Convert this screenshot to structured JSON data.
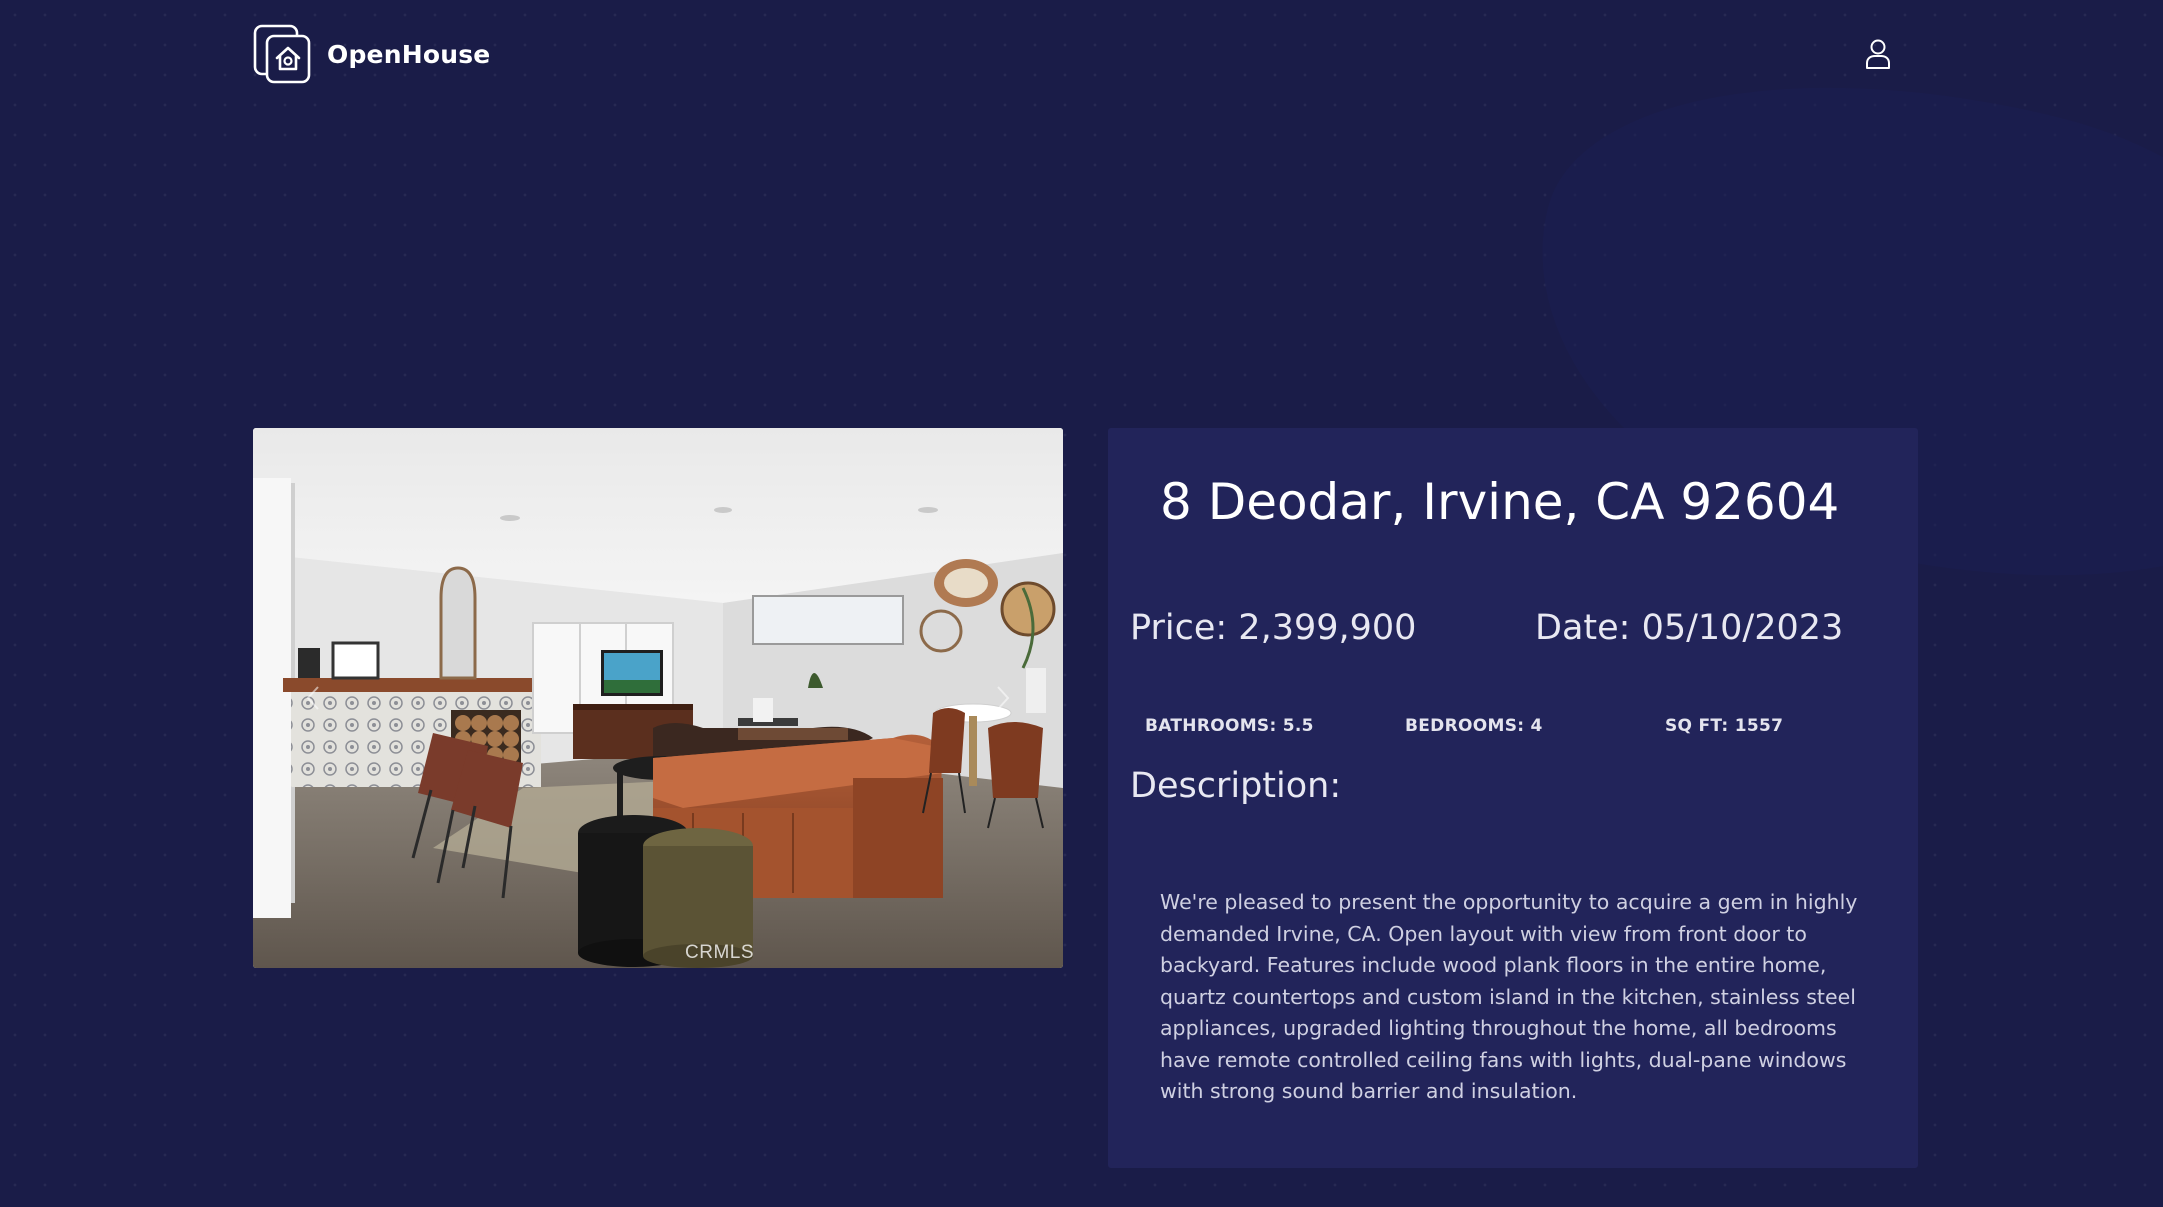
{
  "header": {
    "brand_name": "OpenHouse",
    "logo_icon": "house-logo-icon",
    "user_icon": "user-account-icon"
  },
  "gallery": {
    "watermark": "CRMLS",
    "prev_icon": "chevron-left-icon",
    "next_icon": "chevron-right-icon"
  },
  "listing": {
    "address": "8 Deodar, Irvine, CA 92604",
    "price_text": "Price: 2,399,900",
    "date_text": "Date: 05/10/2023",
    "bathrooms_text": "BATHROOMS: 5.5",
    "bedrooms_text": "BEDROOMS: 4",
    "sqft_text": "SQ FT: 1557",
    "description_heading": "Description:",
    "description": "We're pleased to present the opportunity to acquire a gem in highly demanded Irvine, CA. Open layout with view from front door to backyard. Features include wood plank floors in the entire home, quartz countertops and custom island in the kitchen, stainless steel appliances, upgraded lighting throughout the home, all bedrooms have remote controlled ceiling fans with lights, dual-pane windows with strong sound barrier and insulation."
  },
  "colors": {
    "page_background": "#1a1c48",
    "card_background": "#22245a",
    "text_primary": "#ffffff"
  }
}
